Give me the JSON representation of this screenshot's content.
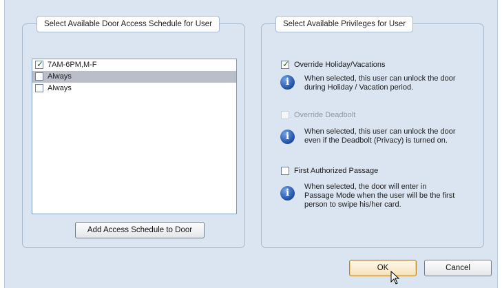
{
  "left_group": {
    "title": "Select Available Door Access Schedule for User",
    "items": [
      {
        "label": "7AM-6PM,M-F",
        "checked": true,
        "selected": false
      },
      {
        "label": "Always",
        "checked": false,
        "selected": true
      },
      {
        "label": "Always",
        "checked": false,
        "selected": false
      }
    ],
    "add_button": "Add Access Schedule to Door"
  },
  "right_group": {
    "title": "Select Available Privileges for User",
    "privileges": [
      {
        "label": "Override Holiday/Vacations",
        "checked": true,
        "enabled": true,
        "info_icon": "info-icon",
        "description": [
          "When selected, this user can unlock the door",
          "during Holiday / Vacation period."
        ]
      },
      {
        "label": "Override Deadbolt",
        "checked": false,
        "enabled": false,
        "info_icon": "info-icon",
        "description": [
          "When selected, this user can unlock the door",
          "even if the Deadbolt (Privacy) is turned on."
        ]
      },
      {
        "label": "First Authorized Passage",
        "checked": false,
        "enabled": true,
        "info_icon": "info-icon",
        "description": [
          "When selected, the door will enter in",
          "Passage Mode when the user will be the first",
          "person to swipe his/her card."
        ]
      }
    ]
  },
  "buttons": {
    "ok": "OK",
    "cancel": "Cancel"
  },
  "glyphs": {
    "check": "✓",
    "info": "i"
  }
}
